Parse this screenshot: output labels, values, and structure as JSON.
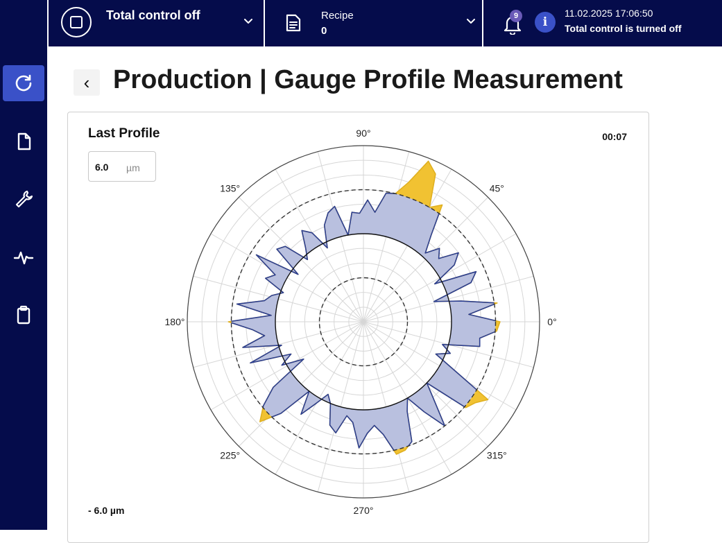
{
  "topbar": {
    "control_title": "Total control off",
    "recipe_label": "Recipe",
    "recipe_value": "0",
    "notification_count": "9",
    "info_symbol": "i",
    "datetime": "11.02.2025 17:06:50",
    "status_message": "Total control is turned off"
  },
  "sidebar": {
    "items": [
      {
        "icon": "refresh-icon",
        "active": true
      },
      {
        "icon": "document-icon",
        "active": false
      },
      {
        "icon": "wrench-icon",
        "active": false
      },
      {
        "icon": "pulse-icon",
        "active": false
      },
      {
        "icon": "clipboard-icon",
        "active": false
      }
    ]
  },
  "header": {
    "back_symbol": "‹",
    "title": "Production | Gauge Profile Measurement"
  },
  "card": {
    "title": "Last Profile",
    "elapsed": "00:07",
    "range_value": "6.0",
    "range_unit": "µm",
    "min_label": "- 6.0 µm"
  },
  "colors": {
    "navy": "#050c4b",
    "accent": "#3a51c8",
    "profile_line": "#2b3f94",
    "profile_fill": "#b9c0df",
    "out_of_tolerance": "#f1c232"
  },
  "chart_data": {
    "type": "polar",
    "angle_labels": [
      "0°",
      "45°",
      "90°",
      "135°",
      "180°",
      "225°",
      "270°",
      "315°"
    ],
    "radial_range": [
      -6.0,
      6.0
    ],
    "radial_unit": "µm",
    "reference_circle": 0,
    "tolerance_circles": [
      -3.0,
      3.0
    ],
    "series": [
      {
        "angles": [
          0,
          4,
          8,
          12,
          16,
          20,
          24,
          28,
          32,
          36,
          40,
          44,
          48,
          52,
          56,
          60,
          64,
          68,
          72,
          76,
          80,
          84,
          88,
          92,
          96,
          100,
          104,
          108,
          112,
          116,
          120,
          124,
          128,
          132,
          136,
          140,
          144,
          148,
          152,
          156,
          160,
          164,
          168,
          172,
          176,
          180,
          184,
          188,
          192,
          196,
          200,
          204,
          208,
          212,
          216,
          220,
          224,
          228,
          232,
          236,
          240,
          244,
          248,
          252,
          256,
          260,
          264,
          268,
          272,
          276,
          280,
          284,
          288,
          292,
          296,
          300,
          304,
          308,
          312,
          316,
          320,
          324,
          328,
          332,
          336,
          340,
          344,
          348,
          352,
          356
        ],
        "values": [
          3.3,
          1.2,
          3.2,
          0.8,
          -1.0,
          1.8,
          2.4,
          -0.5,
          1.3,
          2.0,
          0.7,
          1.2,
          0.3,
          1.5,
          3.6,
          3.0,
          5.2,
          5.8,
          4.0,
          3.0,
          2.9,
          1.5,
          2.3,
          1.4,
          1.5,
          0.0,
          2.1,
          1.8,
          1.1,
          -0.4,
          1.0,
          1.5,
          0.4,
          -0.3,
          1.4,
          1.7,
          -0.5,
          2.6,
          0.8,
          1.3,
          -0.2,
          0.5,
          0.9,
          2.7,
          0.3,
          3.2,
          1.6,
          0.8,
          2.4,
          -0.2,
          2.2,
          -0.6,
          0.3,
          -1.2,
          1.6,
          2.9,
          3.8,
          2.4,
          0.0,
          1.6,
          0.4,
          -0.5,
          0.0,
          1.4,
          1.8,
          0.5,
          0.9,
          2.6,
          1.6,
          1.1,
          1.8,
          3.3,
          3.2,
          2.8,
          0.8,
          0.0,
          1.4,
          3.0,
          1.2,
          0.0,
          3.1,
          3.4,
          4.0,
          1.0,
          -0.6,
          0.3,
          -0.4,
          2.1,
          2.0,
          3.1
        ]
      }
    ]
  }
}
